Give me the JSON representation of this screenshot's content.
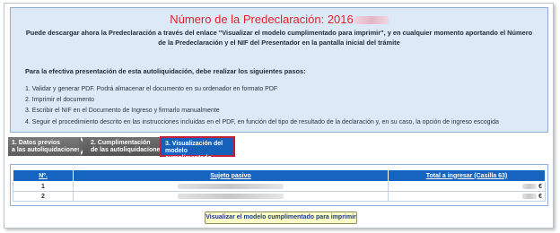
{
  "info": {
    "title": "Número de la Predeclaración: 2016",
    "intro": "Puede descargar ahora la Predeclaración a través del enlace \"Visualizar el modelo cumplimentado para imprimir\", y en cualquier momento aportando el Número de la Predeclaración y el NIF del Presentador en la pantalla inicial del trámite",
    "steps_title": "Para la efectiva presentación de esta autoliquidación, debe realizar los siguientes pasos:",
    "steps": [
      "1. Validar y generar PDF. Podrá almacenar el documento en su ordenador en formato PDF",
      "2. Imprimir el documento",
      "3. Escribir el NIF en el Documento de Ingreso y firmarlo manualmente",
      "4. Seguir el procedimiento descrito en las instrucciones incluidas en el PDF, en función del tipo de resultado de la declaración y, en su caso, la opción de ingreso escogida"
    ]
  },
  "wizard": {
    "step1_line1": "1. Datos previos",
    "step1_line2": "a las autoliquidaciones",
    "step2_line1": "2. Cumplimentación",
    "step2_line2": "de las autoliquidaciones",
    "step3_line1": "3. Visualización del",
    "step3_line2": "modelo cumplimentado"
  },
  "table": {
    "headers": [
      "Nº.",
      "Sujeto pasivo",
      "Total a ingresar (Casilla 63)"
    ],
    "rows": [
      {
        "num": "1",
        "total_suffix": "€"
      },
      {
        "num": "2",
        "total_suffix": "€"
      }
    ]
  },
  "print_button": "Visualizar el modelo cumplimentado para imprimir"
}
